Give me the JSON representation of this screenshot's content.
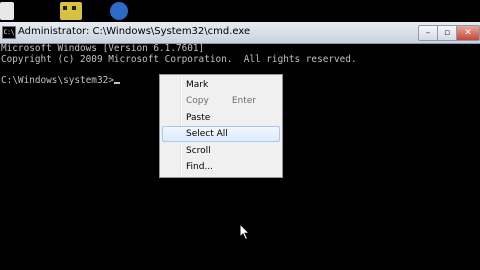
{
  "window": {
    "title": "Administrator: C:\\Windows\\System32\\cmd.exe",
    "buttons": {
      "minimize": "–",
      "maximize": "▫",
      "close": "✕"
    },
    "icon_text": "C:\\"
  },
  "console": {
    "lines": [
      "Microsoft Windows [Version 6.1.7601]",
      "Copyright (c) 2009 Microsoft Corporation.  All rights reserved.",
      "",
      "C:\\Windows\\system32>"
    ]
  },
  "context_menu": {
    "items": [
      {
        "label": "Mark",
        "shortcut": "",
        "disabled": false,
        "highlighted": false
      },
      {
        "label": "Copy",
        "shortcut": "Enter",
        "disabled": true,
        "highlighted": false
      },
      {
        "label": "Paste",
        "shortcut": "",
        "disabled": false,
        "highlighted": false
      },
      {
        "label": "Select All",
        "shortcut": "",
        "disabled": false,
        "highlighted": true
      },
      {
        "label": "Scroll",
        "shortcut": "",
        "disabled": false,
        "highlighted": false
      },
      {
        "label": "Find...",
        "shortcut": "",
        "disabled": false,
        "highlighted": false
      }
    ]
  },
  "colors": {
    "console_bg": "#000000",
    "console_text": "#c0c0c0",
    "menu_bg": "#f0f0f0",
    "menu_highlight": "#dcebfc"
  }
}
